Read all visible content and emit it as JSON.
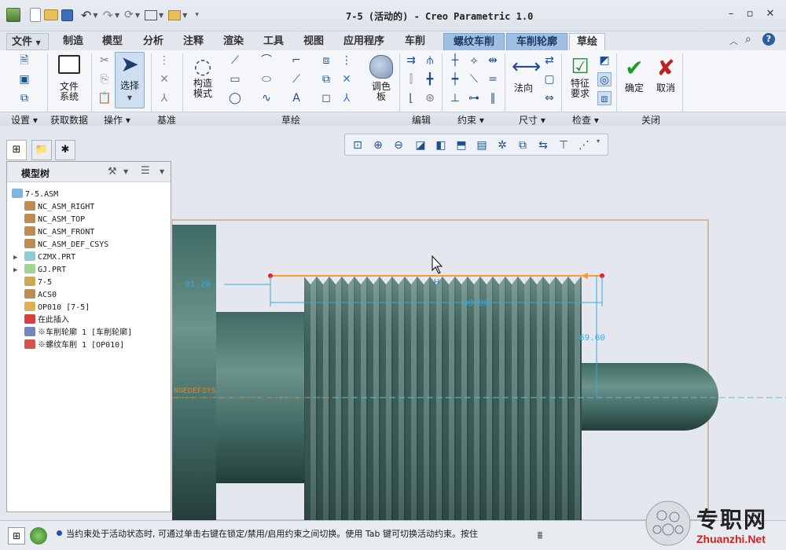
{
  "window": {
    "title": "7-5 (活动的) - Creo Parametric 1.0"
  },
  "tabs": [
    {
      "label": "文件"
    },
    {
      "label": "制造"
    },
    {
      "label": "模型"
    },
    {
      "label": "分析"
    },
    {
      "label": "注释"
    },
    {
      "label": "渲染"
    },
    {
      "label": "工具"
    },
    {
      "label": "视图"
    },
    {
      "label": "应用程序"
    },
    {
      "label": "车削"
    },
    {
      "label": "螺纹车削"
    },
    {
      "label": "车削轮廓"
    },
    {
      "label": "草绘"
    }
  ],
  "ribbon": {
    "buttons": {
      "file_system": "文件\n系统",
      "select": "选择",
      "construction_mode": "构造\n模式",
      "palette": "调色\n板",
      "normal": "法向",
      "feature_requirements": "特征\n要求",
      "ok": "确定",
      "cancel": "取消"
    },
    "groups": [
      {
        "label": "设置 ▾"
      },
      {
        "label": "获取数据"
      },
      {
        "label": "操作 ▾"
      },
      {
        "label": "基准"
      },
      {
        "label": "草绘"
      },
      {
        "label": "编辑"
      },
      {
        "label": "约束 ▾"
      },
      {
        "label": "尺寸 ▾"
      },
      {
        "label": "检查 ▾"
      },
      {
        "label": "关闭"
      }
    ]
  },
  "model_tree": {
    "title": "模型树",
    "items": [
      {
        "label": "7-5.ASM",
        "icon": "assembly-icon",
        "color": "#6aa9d8"
      },
      {
        "label": "NC_ASM_RIGHT",
        "icon": "datum-plane-icon",
        "color": "#b07a3a"
      },
      {
        "label": "NC_ASM_TOP",
        "icon": "datum-plane-icon",
        "color": "#b07a3a"
      },
      {
        "label": "NC_ASM_FRONT",
        "icon": "datum-plane-icon",
        "color": "#b07a3a"
      },
      {
        "label": "NC_ASM_DEF_CSYS",
        "icon": "csys-icon",
        "color": "#b07a3a"
      },
      {
        "label": "CZMX.PRT",
        "icon": "part-icon",
        "color": "#7ec4c8"
      },
      {
        "label": "GJ.PRT",
        "icon": "part-icon",
        "color": "#8fd07c"
      },
      {
        "label": "7-5",
        "icon": "workcell-icon",
        "color": "#c49a3a"
      },
      {
        "label": "ACS0",
        "icon": "csys-icon",
        "color": "#b07a3a"
      },
      {
        "label": "OP010 [7-5]",
        "icon": "operation-icon",
        "color": "#d4a437"
      },
      {
        "label": "在此插入",
        "icon": "insert-arrow-icon",
        "color": "#d21f1f"
      },
      {
        "label": "※车削轮廓 1 [车削轮廓]",
        "icon": "turn-profile-icon",
        "color": "#5a6fb4"
      },
      {
        "label": "※螺纹车削 1 [OP010]",
        "icon": "thread-turn-icon",
        "color": "#c9362f"
      }
    ]
  },
  "sketch": {
    "dim_left": "91.20",
    "dim_length": "90.00",
    "dim_height": "69.60",
    "axis_label": "NSEDEFSYS"
  },
  "status": {
    "message": "当约束处于活动状态时, 可通过单击右键在锁定/禁用/启用约束之间切换。使用 Tab 键可切换活动约束。按住"
  },
  "watermark": {
    "text": "专职网",
    "url": "Zhuanzhi.Net"
  }
}
